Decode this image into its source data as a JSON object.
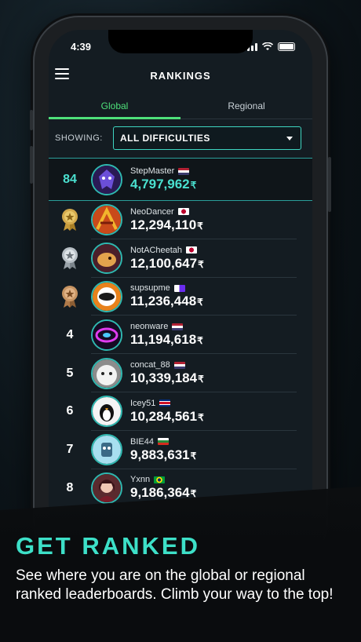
{
  "status": {
    "time": "4:39"
  },
  "header": {
    "title": "RANKINGS"
  },
  "tabs": [
    {
      "label": "Global"
    },
    {
      "label": "Regional"
    }
  ],
  "filter": {
    "label": "SHOWING:",
    "value": "ALL DIFFICULTIES"
  },
  "currency_symbol": "₹",
  "my_entry": {
    "rank": "84",
    "name": "StepMaster",
    "score": "4,797,962"
  },
  "leaderboard": [
    {
      "rank": "",
      "medal": "gold",
      "name": "NeoDancer",
      "score": "12,294,110"
    },
    {
      "rank": "",
      "medal": "silver",
      "name": "NotACheetah",
      "score": "12,100,647"
    },
    {
      "rank": "",
      "medal": "bronze",
      "name": "supsupme",
      "score": "11,236,448"
    },
    {
      "rank": "4",
      "name": "neonware",
      "score": "11,194,618"
    },
    {
      "rank": "5",
      "name": "concat_88",
      "score": "10,339,184"
    },
    {
      "rank": "6",
      "name": "Icey51",
      "score": "10,284,561"
    },
    {
      "rank": "7",
      "name": "BIE44",
      "score": "9,883,631"
    },
    {
      "rank": "8",
      "name": "Yxnn",
      "score": "9,186,364"
    }
  ],
  "promo": {
    "headline": "GET RANKED",
    "description": "See where you are on the global or regional ranked leaderboards. Climb your way to the top!"
  },
  "colors": {
    "accent": "#3de0c8",
    "tab_active": "#4ee07a",
    "background": "#141c22"
  }
}
